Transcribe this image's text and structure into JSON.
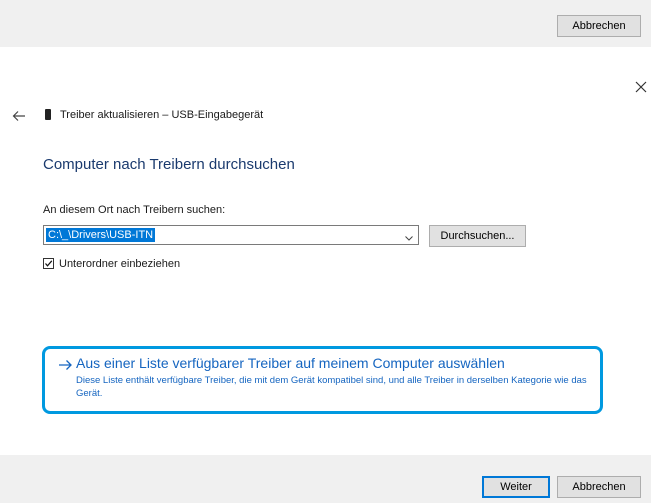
{
  "top_bar": {
    "cancel_label": "Abbrechen"
  },
  "header": {
    "window_title": "Treiber aktualisieren – USB-Eingabegerät"
  },
  "main": {
    "page_title": "Computer nach Treibern durchsuchen",
    "path_label": "An diesem Ort nach Treibern suchen:",
    "path_value": "C:\\_\\Drivers\\USB-ITN",
    "browse_label": "Durchsuchen...",
    "include_subfolders_label": "Unterordner einbeziehen",
    "include_subfolders_checked": true,
    "list_option": {
      "title": "Aus einer Liste verfügbarer Treiber auf meinem Computer auswählen",
      "description": "Diese Liste enthält verfügbare Treiber, die mit dem Gerät kompatibel sind, und alle Treiber in derselben Kategorie wie das Gerät."
    }
  },
  "footer": {
    "next_label": "Weiter",
    "cancel_label": "Abbrechen"
  },
  "colors": {
    "accent": "#0078d7",
    "link": "#1565c0",
    "highlight_border": "#0099e0",
    "bar_background": "#f0f0f0"
  },
  "icons": [
    "close-icon",
    "back-arrow-icon",
    "device-icon",
    "chevron-down-icon",
    "checkmark-icon",
    "arrow-right-icon"
  ]
}
